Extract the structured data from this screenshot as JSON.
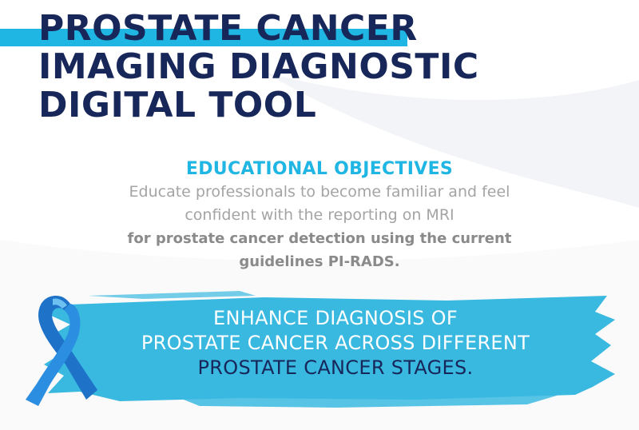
{
  "title": {
    "lines": [
      "PROSTATE CANCER",
      "IMAGING DIAGNOSTIC",
      "DIGITAL TOOL"
    ]
  },
  "objectives": {
    "heading": "EDUCATIONAL OBJECTIVES",
    "lines": [
      "Educate professionals to become familiar and feel",
      "confident with the reporting on MRI",
      "for prostate cancer detection using the current",
      "guidelines PI-RADS."
    ]
  },
  "banner": {
    "lines": [
      "ENHANCE DIAGNOSIS OF",
      "PROSTATE CANCER ACROSS DIFFERENT",
      "PROSTATE CANCER STAGES."
    ]
  },
  "colors": {
    "navy": "#17275a",
    "accent_blue": "#1fb6e3",
    "ribbon_blue": "#1e73c8",
    "gray_text": "#a4a4a4"
  },
  "icons": {
    "ribbon": "awareness-ribbon-icon"
  }
}
